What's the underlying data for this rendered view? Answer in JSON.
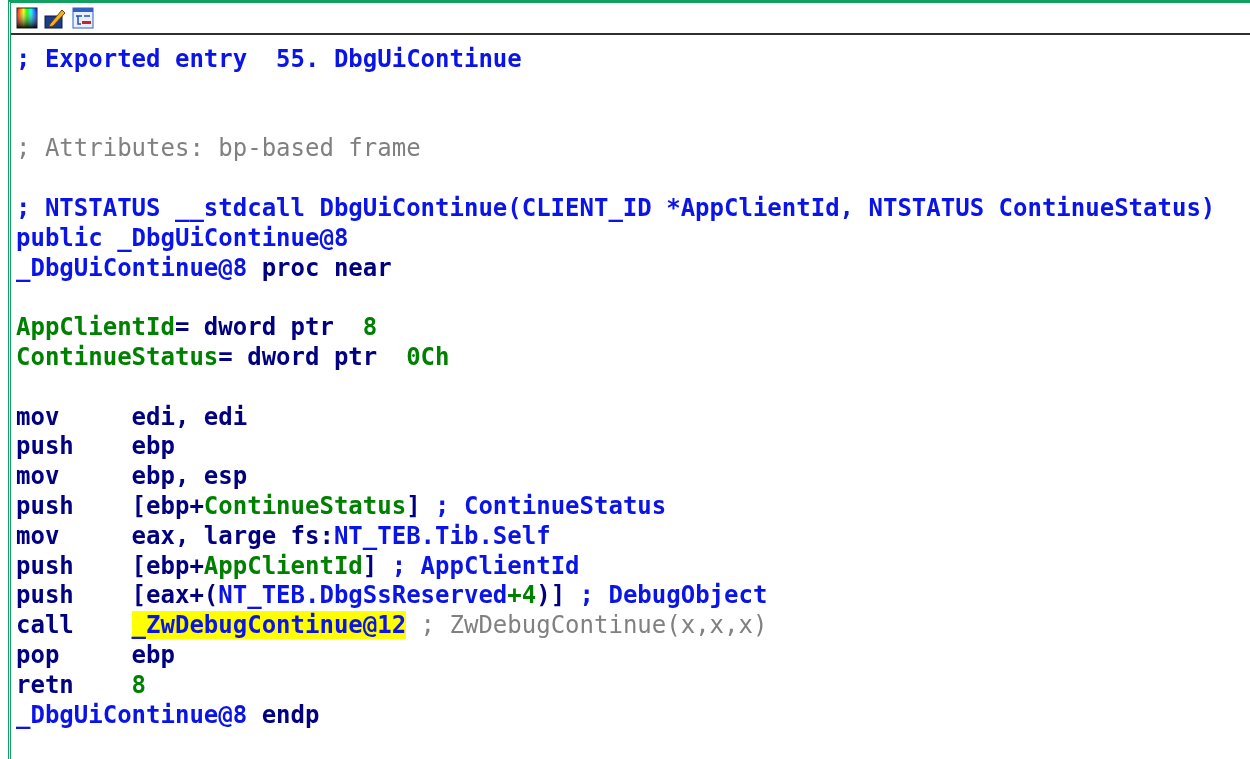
{
  "toolbar": {
    "buttons": [
      {
        "kind": "palette"
      },
      {
        "kind": "pencil"
      },
      {
        "kind": "graph"
      }
    ]
  },
  "listing": [
    {
      "kind": "code",
      "segments": [
        {
          "kind": "comment",
          "text": "; Exported entry  55. DbgUiContinue"
        }
      ]
    },
    {
      "kind": "blank"
    },
    {
      "kind": "blank"
    },
    {
      "kind": "code",
      "segments": [
        {
          "kind": "autocomment",
          "text": "; Attributes: bp-based frame"
        }
      ]
    },
    {
      "kind": "blank"
    },
    {
      "kind": "code",
      "segments": [
        {
          "kind": "comment",
          "text": "; NTSTATUS __stdcall DbgUiContinue(CLIENT_ID *AppClientId, NTSTATUS ContinueStatus)"
        }
      ]
    },
    {
      "kind": "code",
      "segments": [
        {
          "kind": "name",
          "text": "public _DbgUiContinue@8"
        }
      ]
    },
    {
      "kind": "code",
      "segments": [
        {
          "kind": "name",
          "text": "_DbgUiContinue@8"
        },
        {
          "kind": "code",
          "text": " proc near"
        }
      ]
    },
    {
      "kind": "blank"
    },
    {
      "kind": "code",
      "segments": [
        {
          "kind": "local",
          "text": "AppClientId"
        },
        {
          "kind": "code",
          "text": "= dword ptr  "
        },
        {
          "kind": "number",
          "text": "8"
        }
      ]
    },
    {
      "kind": "code",
      "segments": [
        {
          "kind": "local",
          "text": "ContinueStatus"
        },
        {
          "kind": "code",
          "text": "= dword ptr  "
        },
        {
          "kind": "number",
          "text": "0Ch"
        }
      ]
    },
    {
      "kind": "blank"
    },
    {
      "kind": "code",
      "segments": [
        {
          "kind": "mnemonic",
          "text": "mov"
        },
        {
          "kind": "code",
          "text": "edi, edi"
        }
      ]
    },
    {
      "kind": "code",
      "segments": [
        {
          "kind": "mnemonic",
          "text": "push"
        },
        {
          "kind": "code",
          "text": "ebp"
        }
      ]
    },
    {
      "kind": "code",
      "segments": [
        {
          "kind": "mnemonic",
          "text": "mov"
        },
        {
          "kind": "code",
          "text": "ebp, esp"
        }
      ]
    },
    {
      "kind": "code",
      "segments": [
        {
          "kind": "mnemonic",
          "text": "push"
        },
        {
          "kind": "code",
          "text": "[ebp+"
        },
        {
          "kind": "local",
          "text": "ContinueStatus"
        },
        {
          "kind": "code",
          "text": "] "
        },
        {
          "kind": "comment",
          "text": "; ContinueStatus"
        }
      ]
    },
    {
      "kind": "code",
      "segments": [
        {
          "kind": "mnemonic",
          "text": "mov"
        },
        {
          "kind": "code",
          "text": "eax, large fs:"
        },
        {
          "kind": "name",
          "text": "NT_TEB.Tib.Self"
        }
      ]
    },
    {
      "kind": "code",
      "segments": [
        {
          "kind": "mnemonic",
          "text": "push"
        },
        {
          "kind": "code",
          "text": "[ebp+"
        },
        {
          "kind": "local",
          "text": "AppClientId"
        },
        {
          "kind": "code",
          "text": "] "
        },
        {
          "kind": "comment",
          "text": "; AppClientId"
        }
      ]
    },
    {
      "kind": "code",
      "segments": [
        {
          "kind": "mnemonic",
          "text": "push"
        },
        {
          "kind": "code",
          "text": "[eax+("
        },
        {
          "kind": "name",
          "text": "NT_TEB.DbgSsReserved"
        },
        {
          "kind": "number",
          "text": "+4"
        },
        {
          "kind": "code",
          "text": ")] "
        },
        {
          "kind": "comment",
          "text": "; DebugObject"
        }
      ]
    },
    {
      "kind": "code",
      "segments": [
        {
          "kind": "mnemonic",
          "text": "call"
        },
        {
          "kind": "highlight",
          "text": "_ZwDebugContinue@12"
        },
        {
          "kind": "autocomment",
          "text": " ; ZwDebugContinue(x,x,x)"
        }
      ]
    },
    {
      "kind": "code",
      "segments": [
        {
          "kind": "mnemonic",
          "text": "pop"
        },
        {
          "kind": "code",
          "text": "ebp"
        }
      ]
    },
    {
      "kind": "code",
      "segments": [
        {
          "kind": "mnemonic",
          "text": "retn"
        },
        {
          "kind": "number",
          "text": "8"
        }
      ]
    },
    {
      "kind": "code",
      "segments": [
        {
          "kind": "name",
          "text": "_DbgUiContinue@8"
        },
        {
          "kind": "code",
          "text": " endp"
        }
      ]
    }
  ]
}
